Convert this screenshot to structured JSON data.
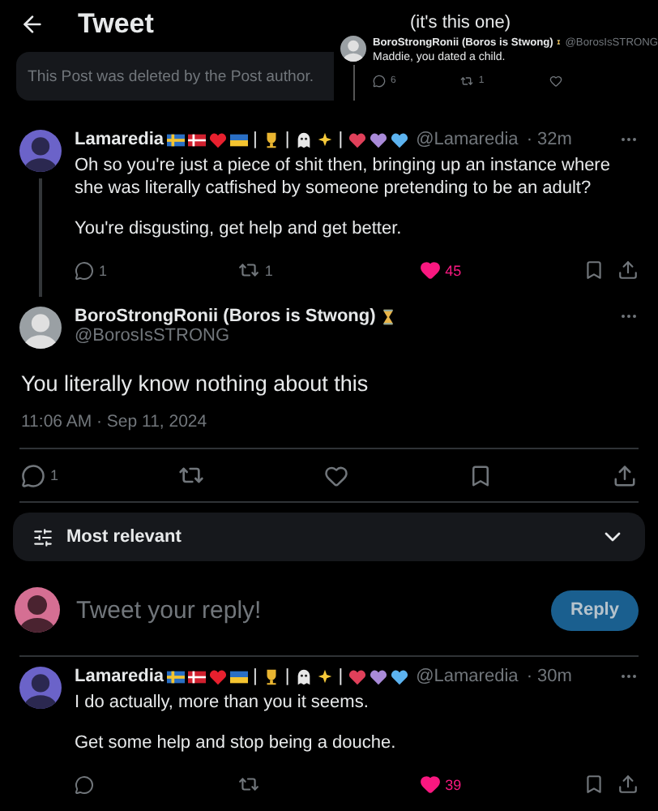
{
  "header": {
    "title": "Tweet"
  },
  "deleted_notice": "This Post was deleted by the Post author.",
  "inset": {
    "caption": "(it's this one)",
    "name": "BoroStrongRonii (Boros is Stwong)",
    "badges": [
      {
        "kind": "hourglass"
      }
    ],
    "handle": "@BorosIsSTRONG",
    "text": "Maddie, you dated a child.",
    "replies": "6",
    "reposts": "1"
  },
  "thread_above": [
    {
      "name": "Lamaredia",
      "badges": [
        {
          "kind": "flag-se"
        },
        {
          "kind": "flag-dk"
        },
        {
          "kind": "heart",
          "color": "#e8202e"
        },
        {
          "kind": "flag-ua"
        },
        {
          "kind": "text",
          "text": "|"
        },
        {
          "kind": "trophy"
        },
        {
          "kind": "text",
          "text": "|"
        },
        {
          "kind": "ghost"
        },
        {
          "kind": "sparkles"
        },
        {
          "kind": "text",
          "text": "|"
        },
        {
          "kind": "heart",
          "color": "#e0405a"
        },
        {
          "kind": "heart",
          "color": "#a98ad8"
        },
        {
          "kind": "heart",
          "color": "#5cb3f0"
        }
      ],
      "handle": "@Lamaredia",
      "time": "· 32m",
      "paragraphs": [
        "Oh so you're just a piece of shit then, bringing up an instance where she was literally catfished by someone pretending to be an adult?",
        "You're disgusting, get help and get better."
      ],
      "replies": "1",
      "reposts": "1",
      "likes": "45",
      "liked": true
    }
  ],
  "main_tweet": {
    "name": "BoroStrongRonii (Boros is Stwong)",
    "badges": [
      {
        "kind": "hourglass"
      }
    ],
    "handle": "@BorosIsSTRONG",
    "text": "You literally know nothing about this",
    "time": "11:06 AM · Sep 11, 2024",
    "replies": "1",
    "liked": false
  },
  "sort": {
    "label": "Most relevant"
  },
  "composer": {
    "placeholder": "Tweet your reply!",
    "button": "Reply"
  },
  "replies": [
    {
      "name": "Lamaredia",
      "badges": [
        {
          "kind": "flag-se"
        },
        {
          "kind": "flag-dk"
        },
        {
          "kind": "heart",
          "color": "#e8202e"
        },
        {
          "kind": "flag-ua"
        },
        {
          "kind": "text",
          "text": "|"
        },
        {
          "kind": "trophy"
        },
        {
          "kind": "text",
          "text": "|"
        },
        {
          "kind": "ghost"
        },
        {
          "kind": "sparkles"
        },
        {
          "kind": "text",
          "text": "|"
        },
        {
          "kind": "heart",
          "color": "#e0405a"
        },
        {
          "kind": "heart",
          "color": "#a98ad8"
        },
        {
          "kind": "heart",
          "color": "#5cb3f0"
        }
      ],
      "handle": "@Lamaredia",
      "time": "· 30m",
      "paragraphs": [
        "I do actually, more than you it seems.",
        "Get some help and stop being a douche."
      ],
      "likes": "39",
      "liked": true
    }
  ]
}
